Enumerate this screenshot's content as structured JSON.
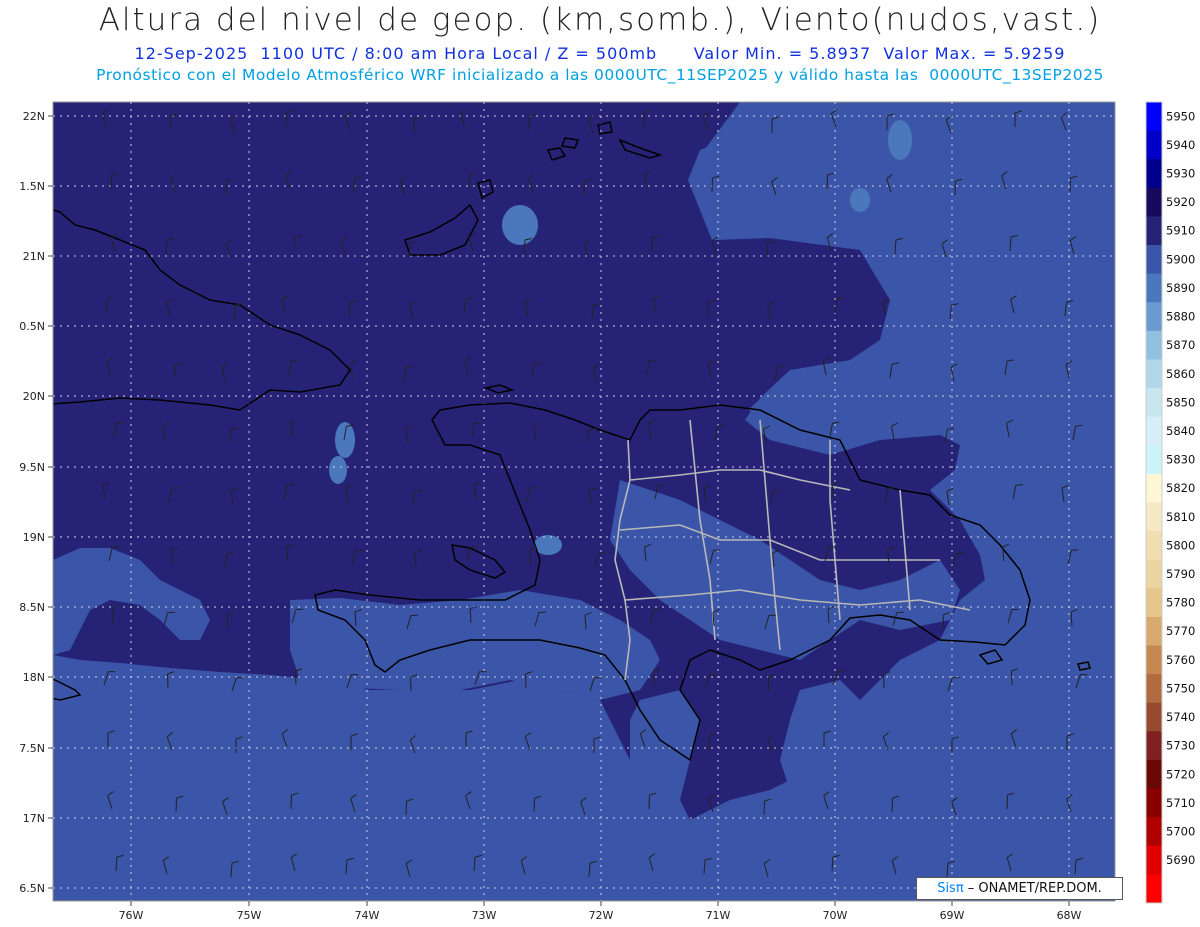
{
  "header": {
    "title": "Altura del nivel de geop. (km,somb.), Viento(nudos,vast.)",
    "line2_date": "12-Sep-2025  1100 UTC / 8:00 am Hora Local / Z = 500mb",
    "line2_minmax": "Valor Min. = 5.8937  Valor Max. = 5.9259",
    "line3": "Pronóstico con el Modelo Atmosférico WRF inicializado a las 0000UTC_11SEP2025 y válido hasta las  0000UTC_13SEP2025"
  },
  "map": {
    "lat_labels": [
      "22N",
      "1.5N",
      "21N",
      "0.5N",
      "20N",
      "9.5N",
      "19N",
      "8.5N",
      "18N",
      "7.5N",
      "17N",
      "6.5N"
    ],
    "lon_labels": [
      "76W",
      "75W",
      "74W",
      "73W",
      "72W",
      "71W",
      "70W",
      "69W",
      "68W"
    ],
    "colors": {
      "level_5910": "#262377",
      "level_5900": "#3b56a8",
      "level_5890": "#4b78bd",
      "coastline": "#000000",
      "province_border": "#b8b8b8",
      "grid": "#d0d0e8"
    }
  },
  "colorbar": {
    "levels": [
      "5950",
      "5940",
      "5930",
      "5920",
      "5910",
      "5900",
      "5890",
      "5880",
      "5870",
      "5860",
      "5850",
      "5840",
      "5830",
      "5820",
      "5810",
      "5800",
      "5790",
      "5780",
      "5770",
      "5760",
      "5750",
      "5740",
      "5730",
      "5720",
      "5710",
      "5700",
      "5690"
    ],
    "colors": [
      "#0000ff",
      "#0000c8",
      "#00008c",
      "#150a5e",
      "#262377",
      "#3b56a8",
      "#4b78bd",
      "#6a9ad0",
      "#90bfe0",
      "#b0d8ea",
      "#c8e6f0",
      "#d6eef5",
      "#ccf4f8",
      "#fff6d6",
      "#f6e8c2",
      "#f0deb0",
      "#ecd4a0",
      "#e6c68a",
      "#d8aa70",
      "#c48850",
      "#b06c40",
      "#984a30",
      "#802020",
      "#6a0808",
      "#8a0000",
      "#b00000",
      "#e00000",
      "#ff0000"
    ]
  },
  "credit": {
    "brand": "Sisπ",
    "text": " – ONAMET/REP.DOM."
  }
}
